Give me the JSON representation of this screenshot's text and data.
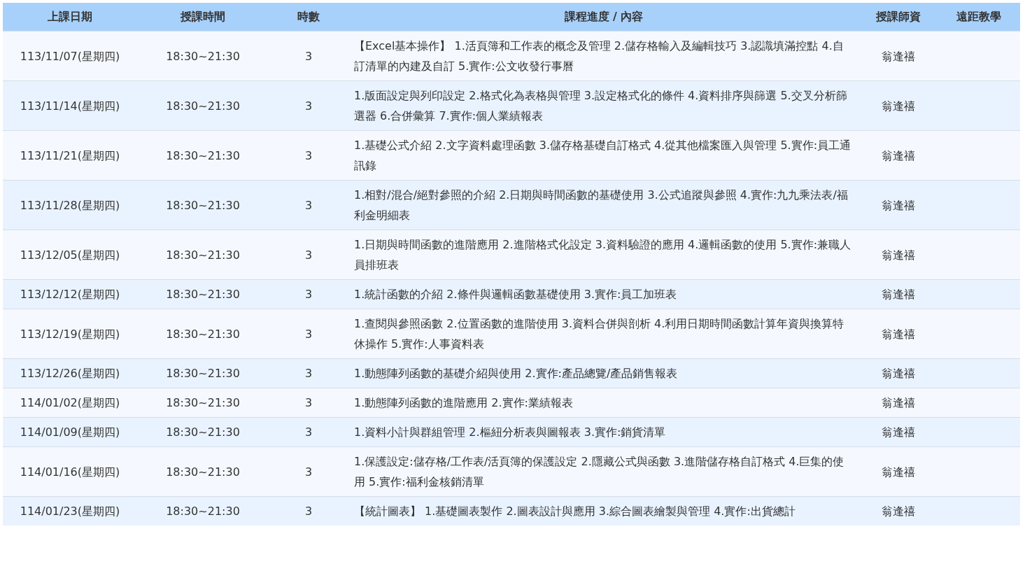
{
  "table": {
    "columns": [
      "上課日期",
      "授課時間",
      "時數",
      "課程進度 / 內容",
      "授課師資",
      "遠距教學"
    ],
    "rows": [
      {
        "date": "113/11/07(星期四)",
        "time": "18:30~21:30",
        "hours": "3",
        "content": "【Excel基本操作】 1.活頁簿和工作表的概念及管理 2.儲存格輸入及編輯技巧 3.認識填滿控點 4.自訂清單的內建及自訂 5.實作:公文收發行事曆",
        "teacher": "翁逢禧"
      },
      {
        "date": "113/11/14(星期四)",
        "time": "18:30~21:30",
        "hours": "3",
        "content": "1.版面設定與列印設定 2.格式化為表格與管理 3.設定格式化的條件 4.資料排序與篩選 5.交叉分析篩選器 6.合併彙算 7.實作:個人業績報表",
        "teacher": "翁逢禧"
      },
      {
        "date": "113/11/21(星期四)",
        "time": "18:30~21:30",
        "hours": "3",
        "content": "1.基礎公式介紹 2.文字資料處理函數 3.儲存格基礎自訂格式 4.從其他檔案匯入與管理 5.實作:員工通訊錄",
        "teacher": "翁逢禧"
      },
      {
        "date": "113/11/28(星期四)",
        "time": "18:30~21:30",
        "hours": "3",
        "content": "1.相對/混合/絕對參照的介紹 2.日期與時間函數的基礎使用 3.公式追蹤與參照 4.實作:九九乘法表/福利金明細表",
        "teacher": "翁逢禧"
      },
      {
        "date": "113/12/05(星期四)",
        "time": "18:30~21:30",
        "hours": "3",
        "content": "1.日期與時間函數的進階應用 2.進階格式化設定 3.資料驗證的應用 4.邏輯函數的使用 5.實作:兼職人員排班表",
        "teacher": "翁逢禧"
      },
      {
        "date": "113/12/12(星期四)",
        "time": "18:30~21:30",
        "hours": "3",
        "content": "1.統計函數的介紹 2.條件與邏輯函數基礎使用 3.實作:員工加班表",
        "teacher": "翁逢禧"
      },
      {
        "date": "113/12/19(星期四)",
        "time": "18:30~21:30",
        "hours": "3",
        "content": "1.查閱與參照函數 2.位置函數的進階使用 3.資料合併與剖析 4.利用日期時間函數計算年資與換算特休操作 5.實作:人事資料表",
        "teacher": "翁逢禧"
      },
      {
        "date": "113/12/26(星期四)",
        "time": "18:30~21:30",
        "hours": "3",
        "content": "1.動態陣列函數的基礎介紹與使用 2.實作:產品總覽/產品銷售報表",
        "teacher": "翁逢禧"
      },
      {
        "date": "114/01/02(星期四)",
        "time": "18:30~21:30",
        "hours": "3",
        "content": "1.動態陣列函數的進階應用 2.實作:業績報表",
        "teacher": "翁逢禧"
      },
      {
        "date": "114/01/09(星期四)",
        "time": "18:30~21:30",
        "hours": "3",
        "content": "1.資料小計與群組管理 2.樞紐分析表與圖報表 3.實作:銷貨清單",
        "teacher": "翁逢禧"
      },
      {
        "date": "114/01/16(星期四)",
        "time": "18:30~21:30",
        "hours": "3",
        "content": "1.保護設定:儲存格/工作表/活頁簿的保護設定 2.隱藏公式與函數 3.進階儲存格自訂格式 4.巨集的使用 5.實作:福利金核銷清單",
        "teacher": "翁逢禧"
      },
      {
        "date": "114/01/23(星期四)",
        "time": "18:30~21:30",
        "hours": "3",
        "content": "【統計圖表】 1.基礎圖表製作 2.圖表設計與應用 3.綜合圖表繪製與管理 4.實作:出貨總計",
        "teacher": "翁逢禧"
      }
    ]
  }
}
